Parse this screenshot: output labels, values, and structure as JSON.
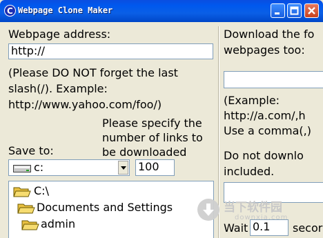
{
  "window": {
    "title": "Webpage Clone Maker"
  },
  "left": {
    "address_label": "Webpage address:",
    "address_value": "http://",
    "note_lines": [
      "(Please DO NOT forget the last",
      "slash(/). Example:",
      "http://www.yahoo.com/foo/)"
    ],
    "links_lines": [
      "Please specify the",
      "number of links to",
      "be downloaded"
    ],
    "save_label": "Save to:",
    "drive_value": "c:",
    "links_value": "100",
    "tree": [
      "C:\\",
      "Documents and Settings",
      "admin"
    ]
  },
  "right": {
    "download_lines": [
      "Download the fo",
      "webpages too:"
    ],
    "example_lines": [
      "(Example:",
      "http://a.com/,h",
      "Use a comma(,)"
    ],
    "exclude_lines": [
      "Do not downlo",
      "included."
    ],
    "wait_label": "Wait",
    "wait_value": "0.1",
    "seconds_label": "secor"
  },
  "watermark": {
    "title": "当下软件园",
    "subtitle": "downxia.com"
  },
  "colors": {
    "titlebar": "#0058ee",
    "window_bg": "#ece9d8",
    "field_border": "#7f9db9"
  }
}
